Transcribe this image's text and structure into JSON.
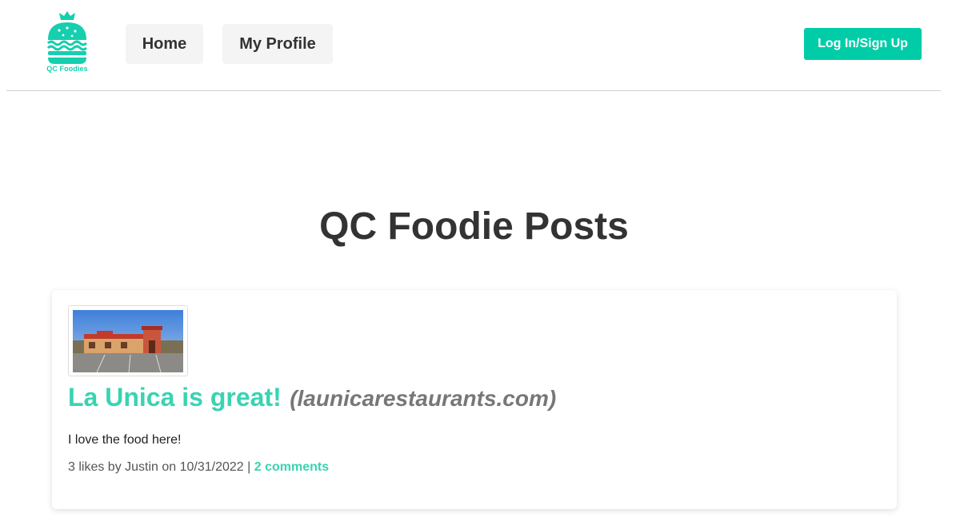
{
  "brand": {
    "logo_text": "QC Foodies",
    "accent_color": "#00cda8"
  },
  "nav": {
    "items": [
      {
        "label": "Home"
      },
      {
        "label": "My Profile"
      }
    ],
    "login_label": "Log In/Sign Up"
  },
  "page": {
    "title": "QC Foodie Posts"
  },
  "posts": [
    {
      "title": "La Unica is great!",
      "domain": "(launicarestaurants.com)",
      "body": "I love the food here!",
      "likes_text": "3 likes by Justin on 10/31/2022",
      "separator": "|",
      "comments_label": "2 comments"
    }
  ]
}
